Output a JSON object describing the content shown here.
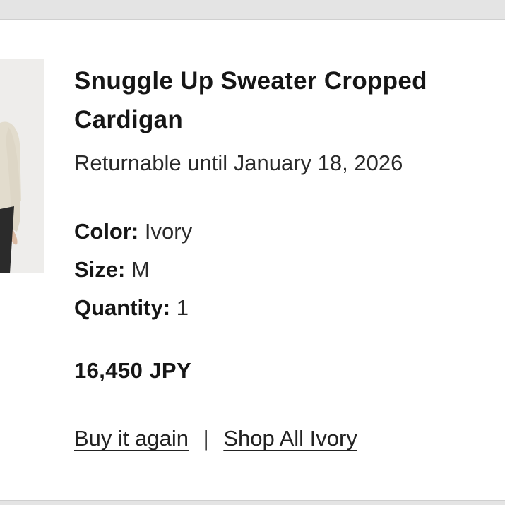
{
  "product": {
    "image_alt": "product-photo",
    "title": "Snuggle Up Sweater Cropped Cardigan",
    "returnable": "Returnable until January 18, 2026",
    "attributes": [
      {
        "label": "Color:",
        "value": "Ivory"
      },
      {
        "label": "Size:",
        "value": "M"
      },
      {
        "label": "Quantity:",
        "value": "1"
      }
    ],
    "price": "16,450 JPY"
  },
  "actions": {
    "buy_again": "Buy it again",
    "separator": "|",
    "shop_all": "Shop All Ivory"
  },
  "colors": {
    "background": "#e4e4e4",
    "card": "#ffffff",
    "text": "#161616"
  }
}
